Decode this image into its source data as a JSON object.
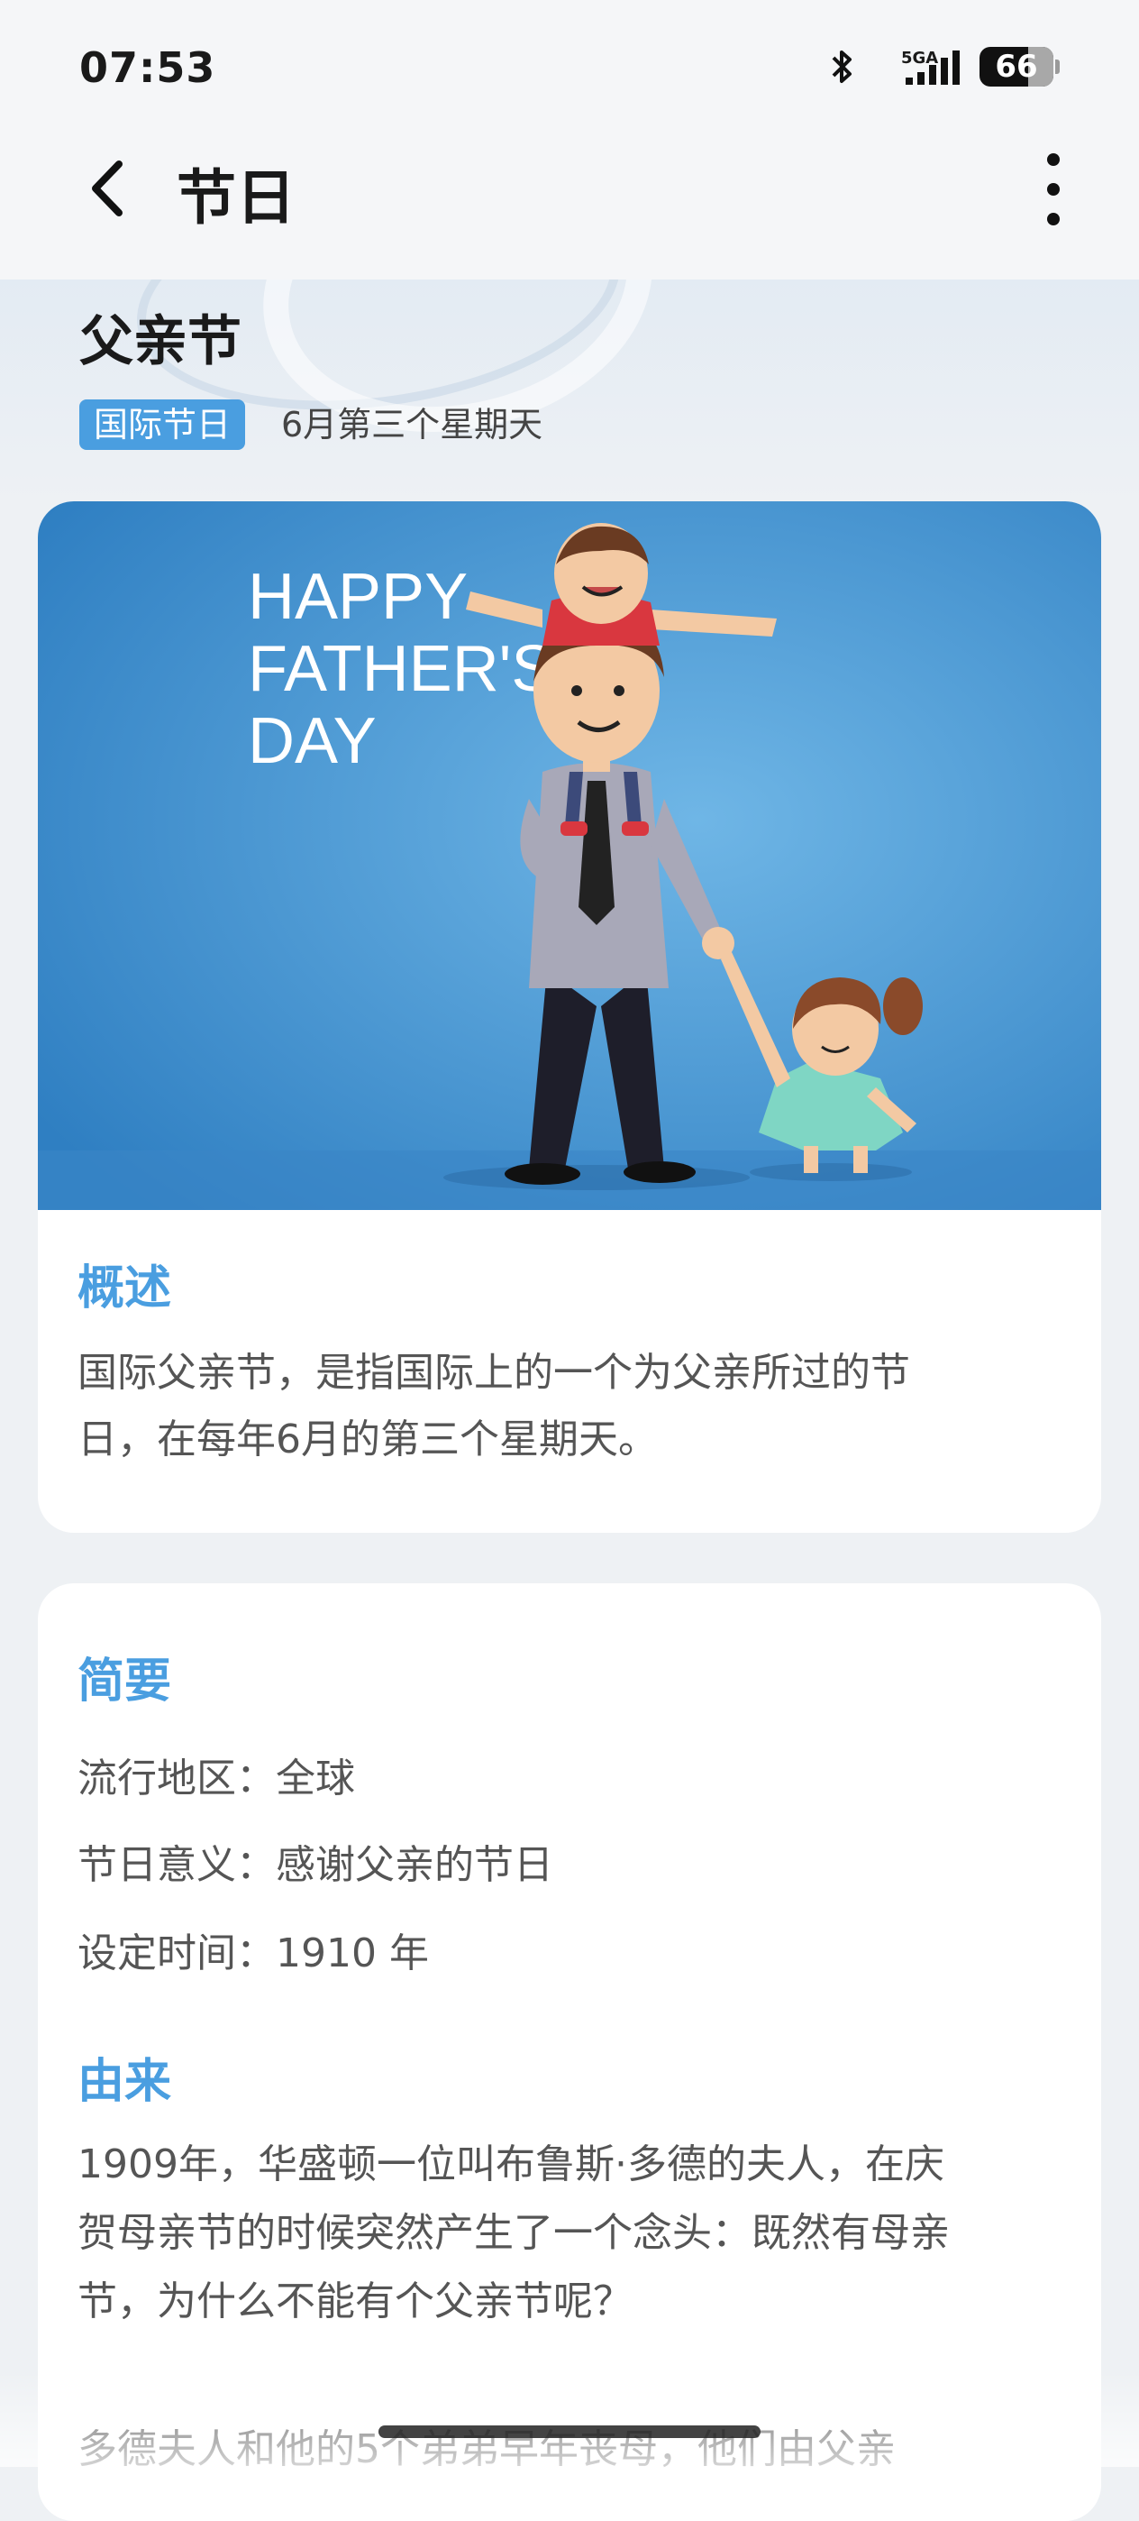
{
  "status_bar": {
    "time": "07:53",
    "network": "5GA",
    "battery": "66",
    "battery_level_percent": 66,
    "bluetooth_icon": "bluetooth-icon",
    "signal_icon": "signal-icon"
  },
  "header": {
    "title": "节日",
    "back_icon": "chevron-left-icon",
    "more_icon": "more-vertical-icon"
  },
  "festival": {
    "name": "父亲节",
    "category": "国际节日",
    "date": "6月第三个星期天",
    "image_text": [
      "HAPPY",
      "FATHER'S",
      "DAY"
    ]
  },
  "overview": {
    "title": "概述",
    "text_line1": "国际父亲节，是指国际上的一个为父亲所过的节",
    "text_line2": "日，在每年6月的第三个星期天。"
  },
  "summary": {
    "title": "简要",
    "rows": [
      {
        "label": "流行地区：",
        "value": "全球"
      },
      {
        "label": "节日意义：",
        "value": "感谢父亲的节日"
      },
      {
        "label": "设定时间：",
        "value": "1910 年"
      }
    ]
  },
  "origin": {
    "title": "由来",
    "line1": "1909年，华盛顿一位叫布鲁斯·多德的夫人，在庆",
    "line2": "贺母亲节的时候突然产生了一个念头：既然有母亲",
    "line3": "节，为什么不能有个父亲节呢？",
    "line4": "多德夫人和他的5个弟弟早年丧母，他们由父亲"
  },
  "colors": {
    "accent": "#4a9ee0",
    "image_bg": "#3d8ccf"
  }
}
